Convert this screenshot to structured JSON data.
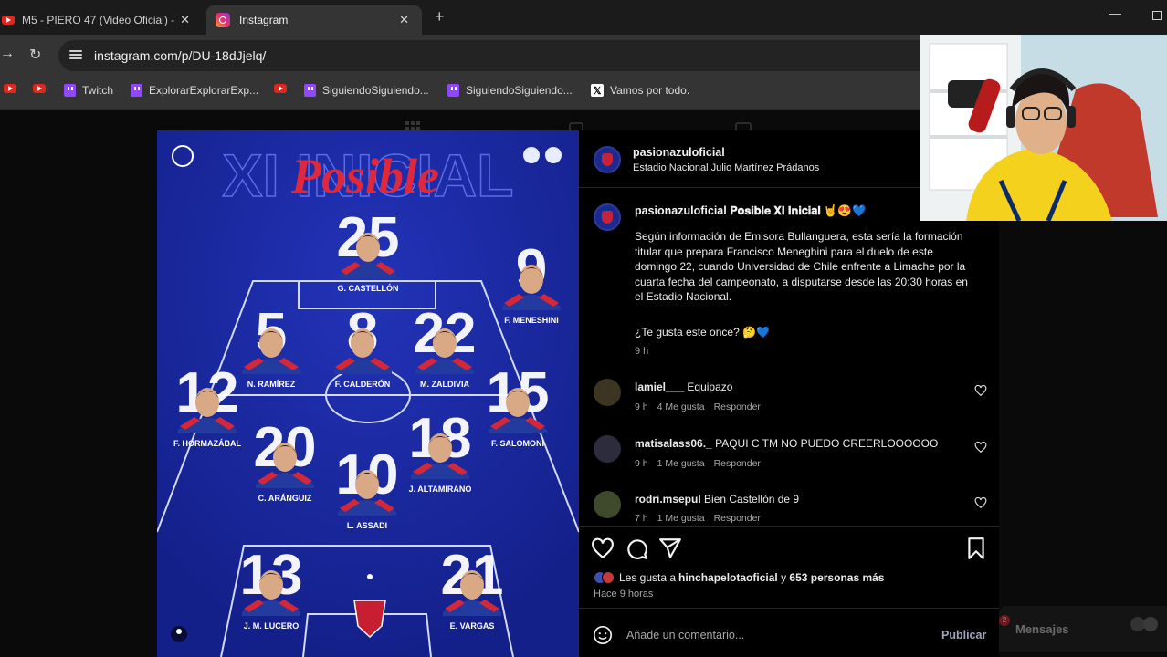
{
  "browser": {
    "tabs": [
      {
        "label": "M5 - PIERO 47 (Video Oficial) -",
        "favicon": "youtube-icon"
      },
      {
        "label": "Instagram",
        "favicon": "instagram-icon",
        "active": true
      }
    ],
    "url": "instagram.com/p/DU-18dJjelq/",
    "bookmarks": [
      {
        "label": "",
        "icon": "youtube-icon"
      },
      {
        "label": "",
        "icon": "youtube-icon"
      },
      {
        "label": "Twitch",
        "icon": "twitch-icon"
      },
      {
        "label": "ExplorarExplorarExp...",
        "icon": "twitch-icon"
      },
      {
        "label": "",
        "icon": "youtube-icon"
      },
      {
        "label": "SiguiendoSiguiendo...",
        "icon": "twitch-icon"
      },
      {
        "label": "SiguiendoSiguiendo...",
        "icon": "twitch-icon"
      },
      {
        "label": "Vamos por todo.",
        "icon": "x-icon"
      }
    ]
  },
  "post_image": {
    "title_back": "XI INICIAL",
    "title_front": "Posible",
    "players": [
      {
        "number": "25",
        "name": "G. CASTELLÓN"
      },
      {
        "number": "9",
        "name": "F. MENESHINI"
      },
      {
        "number": "5",
        "name": "N. RAMÍREZ"
      },
      {
        "number": "8",
        "name": "F. CALDERÓN"
      },
      {
        "number": "22",
        "name": "M. ZALDIVIA"
      },
      {
        "number": "12",
        "name": "F. HORMAZÁBAL"
      },
      {
        "number": "15",
        "name": "F. SALOMONI"
      },
      {
        "number": "20",
        "name": "C. ARÁNGUIZ"
      },
      {
        "number": "18",
        "name": "J. ALTAMIRANO"
      },
      {
        "number": "10",
        "name": "L. ASSADI"
      },
      {
        "number": "13",
        "name": "J. M. LUCERO"
      },
      {
        "number": "21",
        "name": "E. VARGAS"
      }
    ]
  },
  "panel": {
    "author": "pasionazuloficial",
    "location": "Estadio Nacional Julio Martínez Prádanos",
    "caption_user": "pasionazuloficial",
    "caption_title": "𝐏𝐨𝐬𝐢𝐛𝐥𝐞 𝐗𝐈 𝐈𝐧𝐢𝐜𝐢𝐚𝐥 🤘😍💙",
    "caption_body": "Según información de Emisora Bullanguera, esta sería la formación titular que prepara Francisco Meneghini para el duelo de este domingo 22, cuando Universidad de Chile enfrente a Limache por la cuarta fecha del campeonato, a disputarse desde las 20:30 horas en el Estadio Nacional.",
    "caption_question": "¿Te gusta este once? 🤔💙",
    "caption_time": "9 h",
    "comments": [
      {
        "user": "lamiel___",
        "text": "Equipazo",
        "time": "9 h",
        "likes": "4 Me gusta",
        "reply": "Responder"
      },
      {
        "user": "matisalass06._",
        "text": "PAQUI C TM NO PUEDO CREERLOOOOOO",
        "time": "9 h",
        "likes": "1 Me gusta",
        "reply": "Responder"
      },
      {
        "user": "rodri.msepul",
        "text": "Bien Castellón de 9",
        "time": "7 h",
        "likes": "1 Me gusta",
        "reply": "Responder"
      }
    ],
    "likes_prefix": "Les gusta a ",
    "likes_user": "hinchapelotaoficial",
    "likes_middle": " y ",
    "likes_count": "653 personas más",
    "posted_ago": "Hace 9 horas",
    "comment_placeholder": "Añade un comentario...",
    "publish_label": "Publicar"
  },
  "messages": {
    "label": "Mensajes",
    "badge": "2"
  },
  "colors": {
    "post_blue": "#1c2aa4",
    "title_red": "#e0283c",
    "accent": "#0095f6"
  }
}
